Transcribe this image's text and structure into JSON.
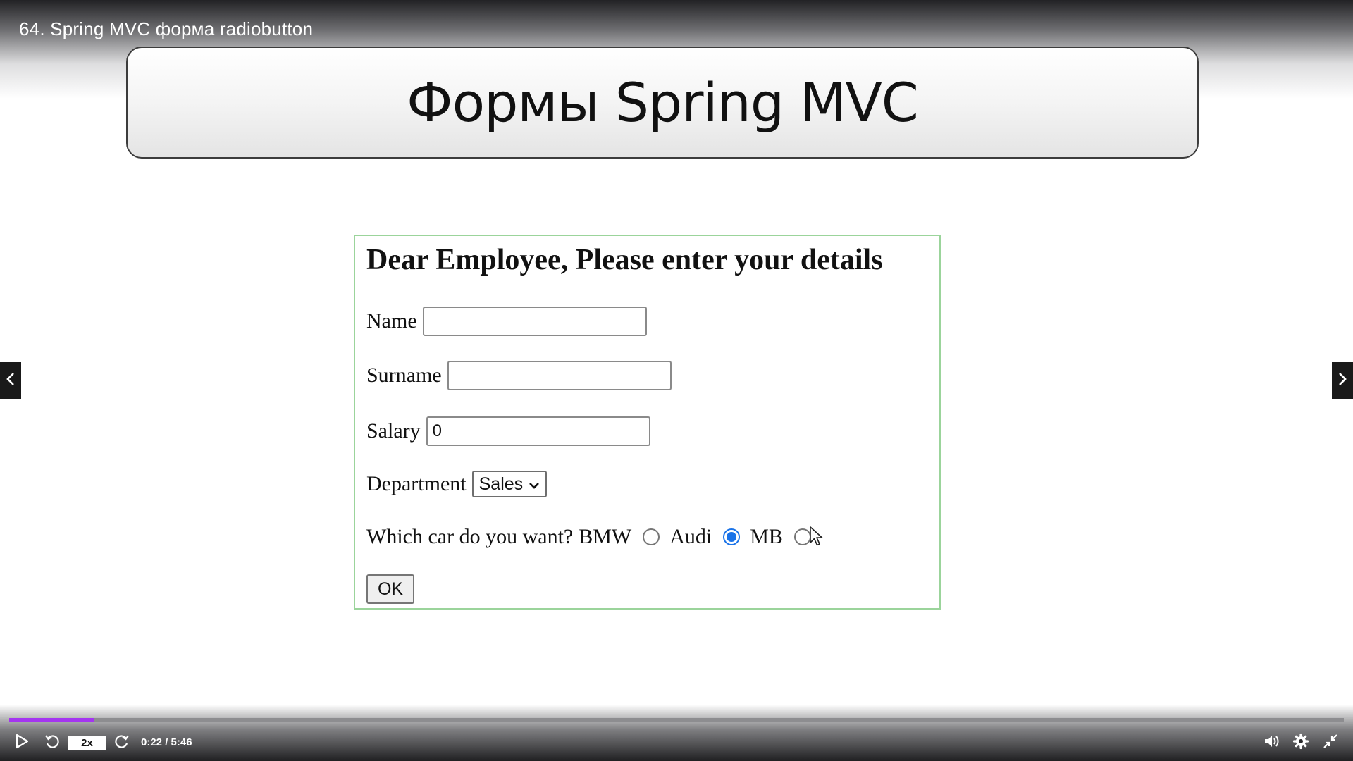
{
  "video": {
    "title": "64. Spring MVC форма radiobutton"
  },
  "slide": {
    "banner_title": "Формы Spring MVC"
  },
  "form": {
    "heading": "Dear Employee, Please enter your details",
    "name_label": "Name",
    "name_value": "",
    "surname_label": "Surname",
    "surname_value": "",
    "salary_label": "Salary",
    "salary_value": "0",
    "department_label": "Department",
    "department_selected": "Sales",
    "car_question": "Which car do you want?",
    "car_options": [
      {
        "label": "BMW",
        "checked": false
      },
      {
        "label": "Audi",
        "checked": true
      },
      {
        "label": "MB",
        "checked": false
      }
    ],
    "submit_label": "OK"
  },
  "player": {
    "speed": "2x",
    "time": "0:22 / 5:46",
    "progress_fraction": 0.064,
    "accent_color": "#a435f0"
  },
  "icons": {
    "prev": "chevron-left-icon",
    "next": "chevron-right-icon",
    "play": "play-icon",
    "rewind": "rewind-icon",
    "forward": "forward-icon",
    "volume": "volume-icon",
    "settings": "gear-icon",
    "exit_fullscreen": "exit-fullscreen-icon",
    "cursor": "mouse-cursor-icon"
  }
}
